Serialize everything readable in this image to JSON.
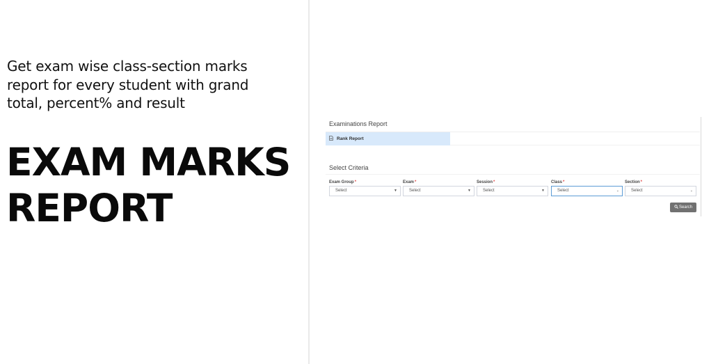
{
  "promo": {
    "tagline": "Get exam wise class-section marks report for every student with grand total, percent% and result",
    "headline": "EXAM MARKS REPORT"
  },
  "app": {
    "page_title": "Examinations Report",
    "report_item": {
      "label": "Rank Report",
      "icon": "document-icon"
    },
    "criteria_title": "Select Criteria",
    "fields": [
      {
        "label": "Exam Group",
        "required_mark": "*",
        "value": "Select"
      },
      {
        "label": "Exam",
        "required_mark": "*",
        "value": "Select"
      },
      {
        "label": "Session",
        "required_mark": "*",
        "value": "Select"
      },
      {
        "label": "Class",
        "required_mark": "*",
        "value": "Select"
      },
      {
        "label": "Section",
        "required_mark": "*",
        "value": "Select"
      }
    ],
    "search_button": {
      "label": "Search",
      "icon": "search-icon"
    },
    "colors": {
      "selected_item_bg": "#d8e9fb",
      "required": "#e04b4b",
      "button_bg": "#717171",
      "focus_border": "#5b9bd5"
    }
  }
}
